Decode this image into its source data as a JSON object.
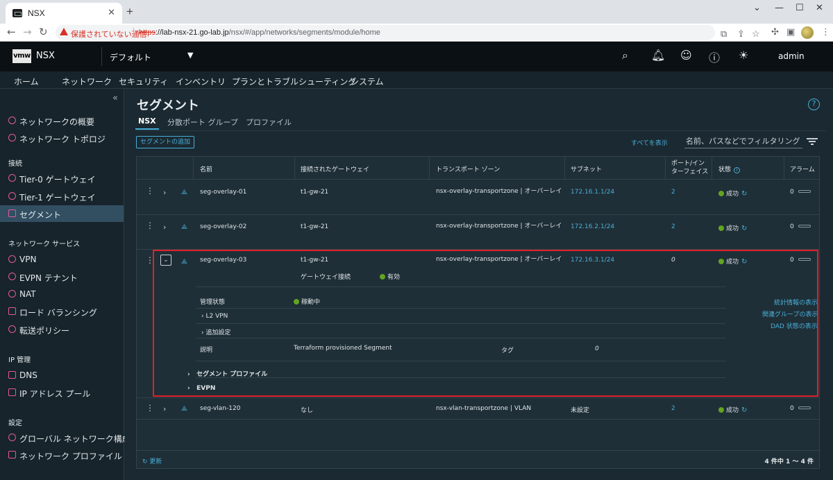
{
  "browser": {
    "tab_title": "NSX",
    "security_warning": "保護されていない通信",
    "url_scheme": "https",
    "url_host": "://lab-nsx-21.go-lab.jp",
    "url_path": "/nsx/#/app/networks/segments/module/home"
  },
  "header": {
    "logo": "vmw",
    "product": "NSX",
    "tenant": "デフォルト",
    "user": "admin"
  },
  "main_nav": [
    {
      "label": "ホーム"
    },
    {
      "label": "ネットワーク"
    },
    {
      "label": "セキュリティ"
    },
    {
      "label": "インベントリ"
    },
    {
      "label": "プランとトラブルシューティング"
    },
    {
      "label": "システム"
    }
  ],
  "sidebar": {
    "items_top": [
      {
        "label": "ネットワークの概要"
      },
      {
        "label": "ネットワーク トポロジ"
      }
    ],
    "sec_connect": "接続",
    "connect": [
      {
        "label": "Tier-0 ゲートウェイ"
      },
      {
        "label": "Tier-1 ゲートウェイ"
      },
      {
        "label": "セグメント"
      }
    ],
    "sec_services": "ネットワーク サービス",
    "services": [
      {
        "label": "VPN"
      },
      {
        "label": "EVPN テナント"
      },
      {
        "label": "NAT"
      },
      {
        "label": "ロード バランシング"
      },
      {
        "label": "転送ポリシー"
      }
    ],
    "sec_ip": "IP 管理",
    "ip": [
      {
        "label": "DNS"
      },
      {
        "label": "IP アドレス プール"
      }
    ],
    "sec_settings": "設定",
    "settings": [
      {
        "label": "グローバル ネットワーク構成"
      },
      {
        "label": "ネットワーク プロファイル"
      }
    ]
  },
  "page": {
    "title": "セグメント",
    "tabs": [
      {
        "label": "NSX"
      },
      {
        "label": "分散ポート グループ"
      },
      {
        "label": "プロファイル"
      }
    ],
    "add_button": "セグメントの追加",
    "show_all": "すべてを表示",
    "filter_placeholder": "名前、パスなどでフィルタリング"
  },
  "table": {
    "headers": {
      "name": "名前",
      "gateway": "接続されたゲートウェイ",
      "tz": "トランスポート ゾーン",
      "subnet": "サブネット",
      "ports_line1": "ポート/イン",
      "ports_line2": "ターフェイス",
      "status": "状態",
      "alarm": "アラーム"
    },
    "rows": [
      {
        "name": "seg-overlay-01",
        "gateway": "t1-gw-21",
        "tz": "nsx-overlay-transportzone | オーバーレイ",
        "subnet": "172.16.1.1/24",
        "ports": "2",
        "status": "成功",
        "alarm": "0"
      },
      {
        "name": "seg-overlay-02",
        "gateway": "t1-gw-21",
        "tz": "nsx-overlay-transportzone | オーバーレイ",
        "subnet": "172.16.2.1/24",
        "ports": "2",
        "status": "成功",
        "alarm": "0"
      },
      {
        "name": "seg-overlay-03",
        "gateway": "t1-gw-21",
        "tz": "nsx-overlay-transportzone | オーバーレイ",
        "subnet": "172.16.3.1/24",
        "ports": "0",
        "status": "成功",
        "alarm": "0"
      },
      {
        "name": "seg-vlan-120",
        "gateway": "なし",
        "tz": "nsx-vlan-transportzone | VLAN",
        "subnet": "未設定",
        "ports": "2",
        "status": "成功",
        "alarm": "0"
      }
    ],
    "expanded": {
      "gw_conn_label": "ゲートウェイ接続",
      "gw_conn_value": "有効",
      "admin_label": "管理状態",
      "admin_value": "稼動中",
      "l2vpn": "L2 VPN",
      "additional": "追加設定",
      "desc_label": "説明",
      "desc_value": "Terraform provisioned Segment",
      "tag_label": "タグ",
      "tag_value": "0",
      "seg_profiles": "セグメント プロファイル",
      "evpn": "EVPN",
      "link_stats": "統計情報の表示",
      "link_groups": "関連グループの表示",
      "link_dad": "DAD 状態の表示"
    },
    "footer_refresh": "更新",
    "pager": "4 件中 1 ～ 4 件"
  }
}
